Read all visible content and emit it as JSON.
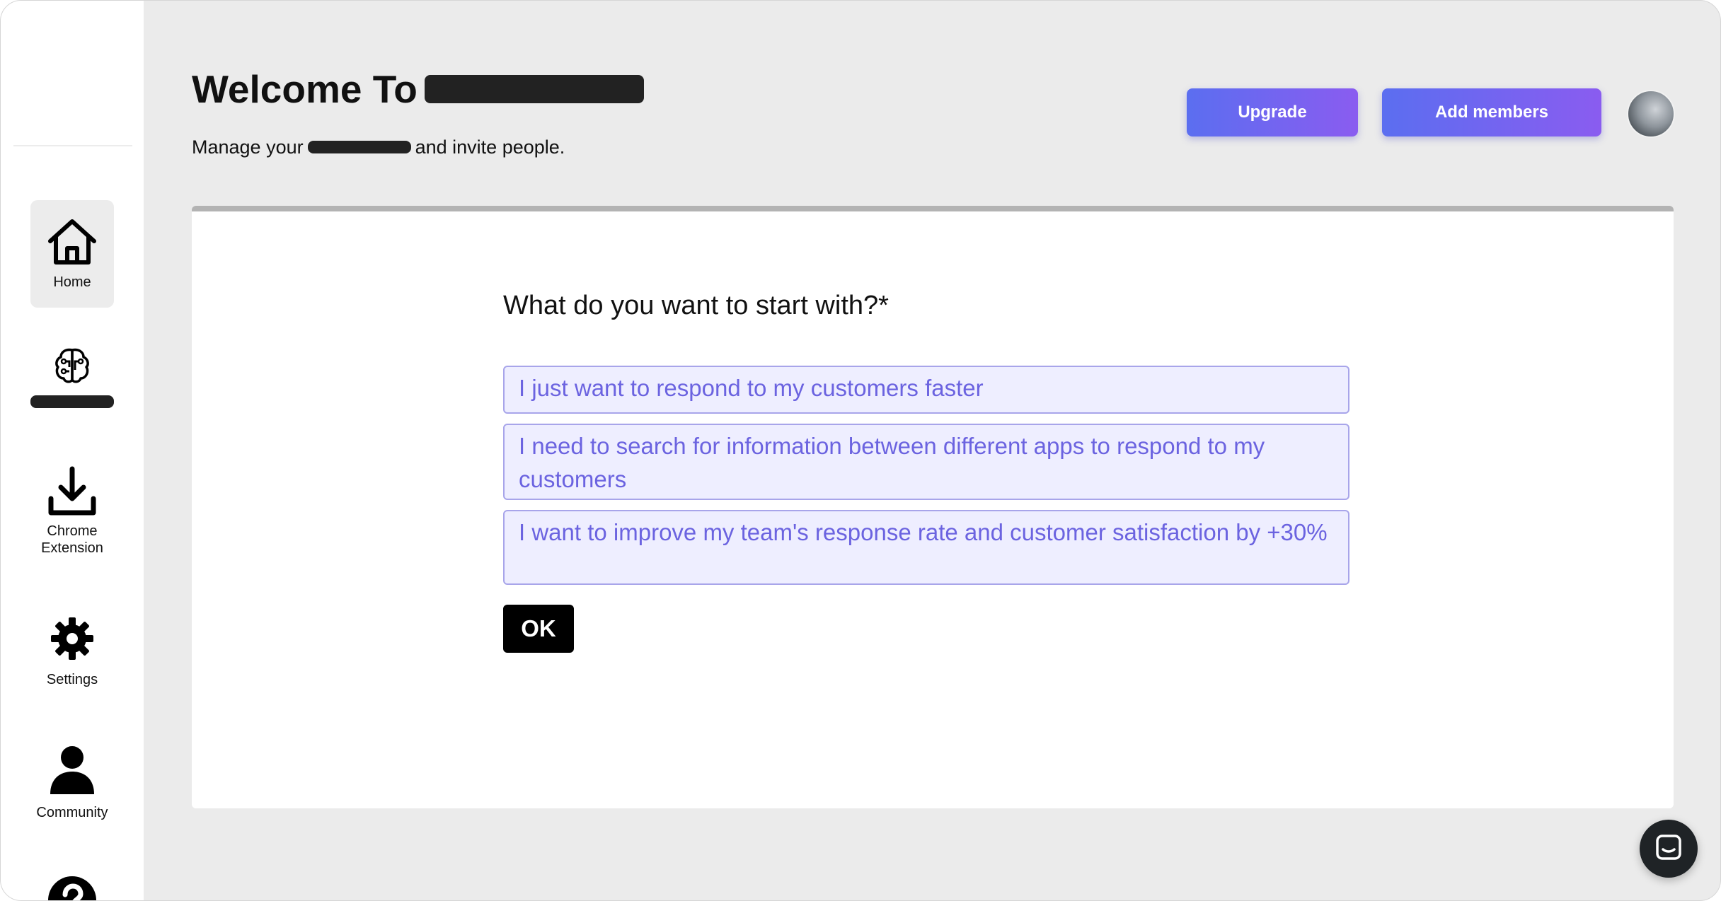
{
  "header": {
    "title_prefix": "Welcome To",
    "subtitle_prefix": "Manage your",
    "subtitle_suffix": "and invite people.",
    "upgrade_label": "Upgrade",
    "add_members_label": "Add members"
  },
  "sidebar": {
    "items": [
      {
        "label": "Home",
        "icon": "home-icon",
        "active": true
      },
      {
        "label": "",
        "icon": "brain-icon",
        "active": false
      },
      {
        "label": "Chrome\nExtension",
        "icon": "download-icon",
        "active": false
      },
      {
        "label": "Settings",
        "icon": "gear-icon",
        "active": false
      },
      {
        "label": "Community",
        "icon": "person-icon",
        "active": false
      },
      {
        "label": "",
        "icon": "help-icon",
        "active": false
      }
    ]
  },
  "form": {
    "question": "What do you want to start with?*",
    "options": [
      "I just want to respond to my customers faster",
      "I need to search for information between different apps to respond to my customers",
      "I want to improve my team's response rate and customer satisfaction by +30%"
    ],
    "ok_label": "OK"
  },
  "colors": {
    "accent_start": "#5b6ef0",
    "accent_end": "#8a5cf0",
    "option_text": "#6b63e0",
    "option_bg": "#eeeeff"
  }
}
